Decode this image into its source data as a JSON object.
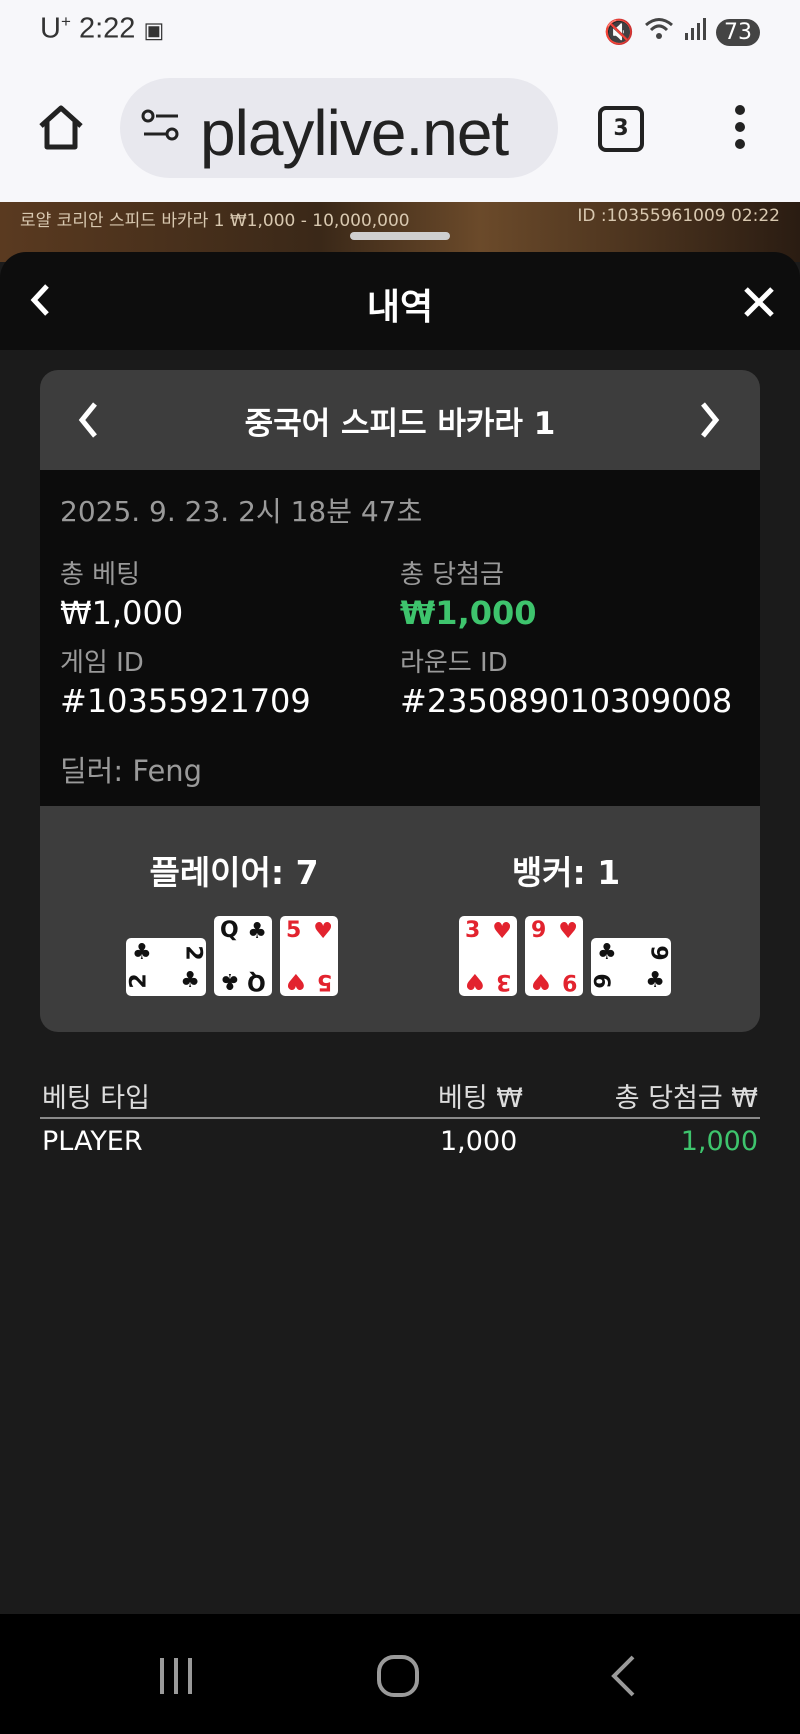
{
  "status": {
    "carrier": "U",
    "carrier_sup": "+",
    "time": "2:22",
    "battery": "73"
  },
  "browser": {
    "url": "playlive.net",
    "tab_count": "3"
  },
  "video": {
    "left_text": "로얄 코리안 스피드 바카라 1 ₩1,000 - 10,000,000",
    "right_text": "ID :10355961009 02:22"
  },
  "modal": {
    "title": "내역",
    "game_name": "중국어 스피드 바카라 1",
    "datetime": "2025. 9. 23. 2시 18분 47초",
    "total_bet_label": "총 베팅",
    "total_bet": "₩1,000",
    "total_win_label": "총 당첨금",
    "total_win": "₩1,000",
    "game_id_label": "게임 ID",
    "game_id": "#10355921709",
    "round_id_label": "라운드 ID",
    "round_id": "#235089010309008",
    "dealer": "딜러: Feng"
  },
  "hands": {
    "player": {
      "title": "플레이어: 7",
      "cards": [
        {
          "rank": "2",
          "suit": "♣",
          "color": "black",
          "rotated": true
        },
        {
          "rank": "Q",
          "suit": "♣",
          "color": "black",
          "rotated": false
        },
        {
          "rank": "5",
          "suit": "♥",
          "color": "red",
          "rotated": false
        }
      ]
    },
    "banker": {
      "title": "뱅커: 1",
      "cards": [
        {
          "rank": "3",
          "suit": "♥",
          "color": "red",
          "rotated": false
        },
        {
          "rank": "9",
          "suit": "♥",
          "color": "red",
          "rotated": false
        },
        {
          "rank": "9",
          "suit": "♣",
          "color": "black",
          "rotated": true
        }
      ]
    }
  },
  "bets_table": {
    "headers": [
      "베팅 타입",
      "베팅 ₩",
      "총 당첨금 ₩"
    ],
    "rows": [
      {
        "type": "PLAYER",
        "bet": "1,000",
        "win": "1,000"
      }
    ]
  },
  "colors": {
    "win_green": "#3ec46d",
    "card_red": "#e2232e",
    "panel_grey": "#3d3d3d"
  },
  "icons": [
    "home-icon",
    "site-settings-icon",
    "tabs-icon",
    "more-menu-icon",
    "back-icon",
    "close-icon",
    "prev-game-icon",
    "next-game-icon",
    "recents-icon",
    "home-nav-icon",
    "back-nav-icon"
  ]
}
